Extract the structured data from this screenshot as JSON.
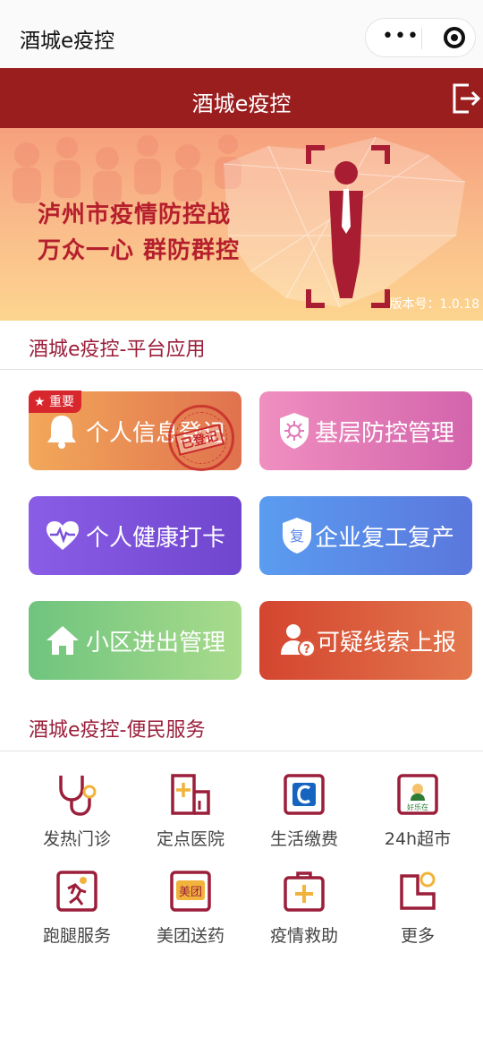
{
  "miniapp_bar": {
    "title": "酒城e疫控"
  },
  "header": {
    "title": "酒城e疫控"
  },
  "banner": {
    "line1": "泸州市疫情防控战",
    "line2": "万众一心 群防群控",
    "version": "版本号：1.0.18"
  },
  "platform": {
    "title": "酒城e疫控-平台应用",
    "cards": [
      {
        "label": "个人信息登记",
        "badge": "★ 重要",
        "stamp": "已登记"
      },
      {
        "label": "基层防控管理"
      },
      {
        "label": "个人健康打卡"
      },
      {
        "label": "企业复工复产",
        "icon_text": "复"
      },
      {
        "label": "小区进出管理"
      },
      {
        "label": "可疑线索上报"
      }
    ]
  },
  "services": {
    "title": "酒城e疫控-便民服务",
    "items": [
      {
        "label": "发热门诊",
        "icon": "stethoscope-icon"
      },
      {
        "label": "定点医院",
        "icon": "hospital-icon"
      },
      {
        "label": "生活缴费",
        "icon": "payment-icon"
      },
      {
        "label": "24h超市",
        "icon": "supermarket-icon",
        "icon_text": "好乐在"
      },
      {
        "label": "跑腿服务",
        "icon": "runner-icon"
      },
      {
        "label": "美团送药",
        "icon": "meituan-icon",
        "icon_text": "美团"
      },
      {
        "label": "疫情救助",
        "icon": "first-aid-kit-icon"
      },
      {
        "label": "更多",
        "icon": "more-icon"
      }
    ]
  },
  "colors": {
    "brand": "#9b1e1f",
    "accent_text": "#9b1e3a"
  }
}
